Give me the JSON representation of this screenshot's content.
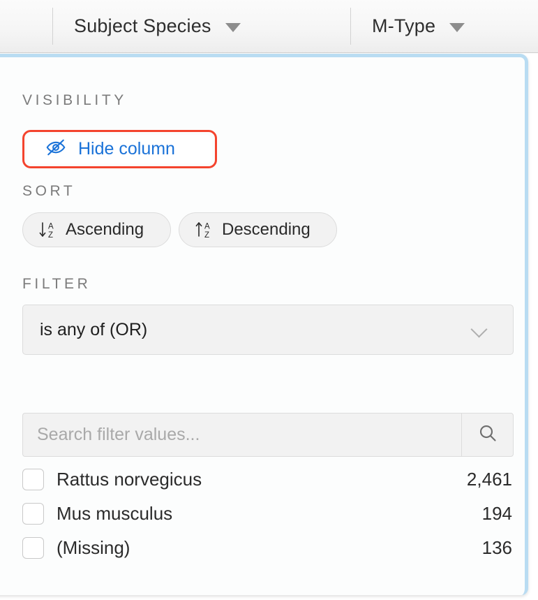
{
  "header": {
    "columns": [
      {
        "label": "Subject Species",
        "caret": "caret-down-icon"
      },
      {
        "label": "M-Type",
        "caret": "caret-down-icon"
      }
    ]
  },
  "panel": {
    "visibility": {
      "section_label": "VISIBILITY",
      "hide_column_label": "Hide column",
      "hide_column_icon": "eye-slash-icon",
      "highlight_color": "#f4442e",
      "link_color": "#1a72d8"
    },
    "sort": {
      "section_label": "SORT",
      "ascending_label": "Ascending",
      "ascending_icon": "sort-alpha-down-icon",
      "descending_label": "Descending",
      "descending_icon": "sort-alpha-up-icon"
    },
    "filter": {
      "section_label": "FILTER",
      "operator_value": "is any of (OR)",
      "operator_caret": "chevron-down-icon",
      "search_placeholder": "Search filter values...",
      "search_value": "",
      "search_icon": "search-icon",
      "values": [
        {
          "name": "Rattus norvegicus",
          "count": "2,461",
          "checked": false
        },
        {
          "name": "Mus musculus",
          "count": "194",
          "checked": false
        },
        {
          "name": "(Missing)",
          "count": "136",
          "checked": false
        }
      ]
    },
    "border_color": "#b9dcf2"
  }
}
